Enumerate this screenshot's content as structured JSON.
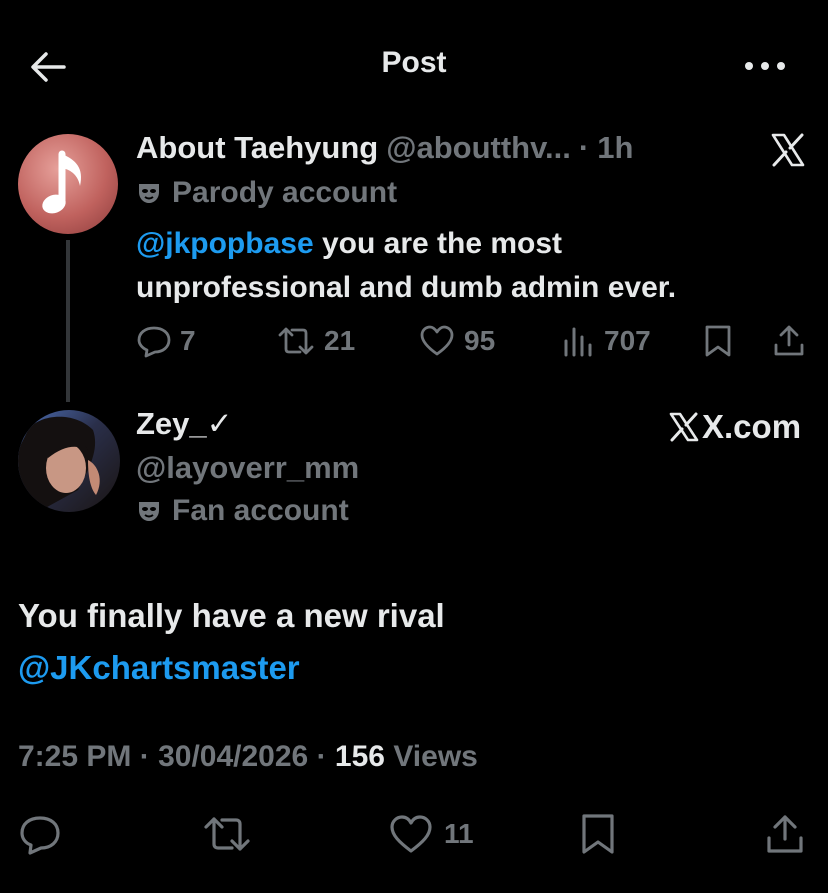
{
  "header": {
    "title": "Post",
    "back_icon": "arrow-left-icon",
    "more_icon": "more-horizontal-icon"
  },
  "quoted_post": {
    "display_name": "About Taehyung",
    "handle": "@aboutthv...",
    "separator": "·",
    "time": "1h",
    "badge_label": "Parody account",
    "mention": "@jkpopbase",
    "text_line1_rest": " you are the most",
    "text_line2": "unprofessional and dumb admin ever.",
    "replies": "7",
    "reposts": "21",
    "likes": "95",
    "views": "707"
  },
  "reply_post": {
    "display_name": "Zey_✓",
    "handle": "@layoverr_mm",
    "badge_label": "Fan account",
    "source": "X.com",
    "text_line1": "You finally have a new rival",
    "mention": "@JKchartsmaster",
    "time": "7:25 PM",
    "date": "30/04/2026",
    "sep1": "·",
    "sep2": "·",
    "view_count": "156",
    "views_label": "Views",
    "likes": "11"
  },
  "colors": {
    "background": "#000000",
    "text_primary": "#e7e9ea",
    "text_secondary": "#71767b",
    "link": "#1d9bf0"
  }
}
